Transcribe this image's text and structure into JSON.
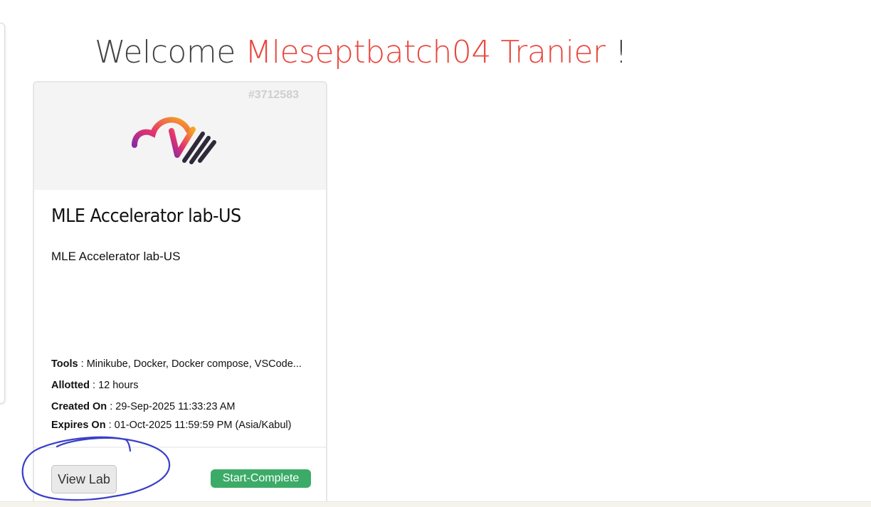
{
  "welcome": {
    "greeting": "Welcome",
    "user_name": "Mleseptbatch04 Tranier",
    "suffix": "!"
  },
  "lab_card": {
    "id": "#3712583",
    "title": "MLE Accelerator lab-US",
    "description": "MLE Accelerator lab-US",
    "tools_label": "Tools",
    "tools_value": "Minikube, Docker, Docker compose, VSCode...",
    "allotted_label": "Allotted",
    "allotted_value": "12 hours",
    "created_label": "Created On",
    "created_value": "29-Sep-2025 11:33:23 AM",
    "expires_label": "Expires On",
    "expires_value": "01-Oct-2025 11:59:59 PM (Asia/Kabul)",
    "separator": ":",
    "view_lab_label": "View Lab",
    "status_label": "Start-Complete",
    "logo_icon": "cloud-check-logo-icon"
  },
  "colors": {
    "accent_name": "#e8473f",
    "status_green": "#3cab67",
    "annotation_ink": "#3a3fc9"
  }
}
